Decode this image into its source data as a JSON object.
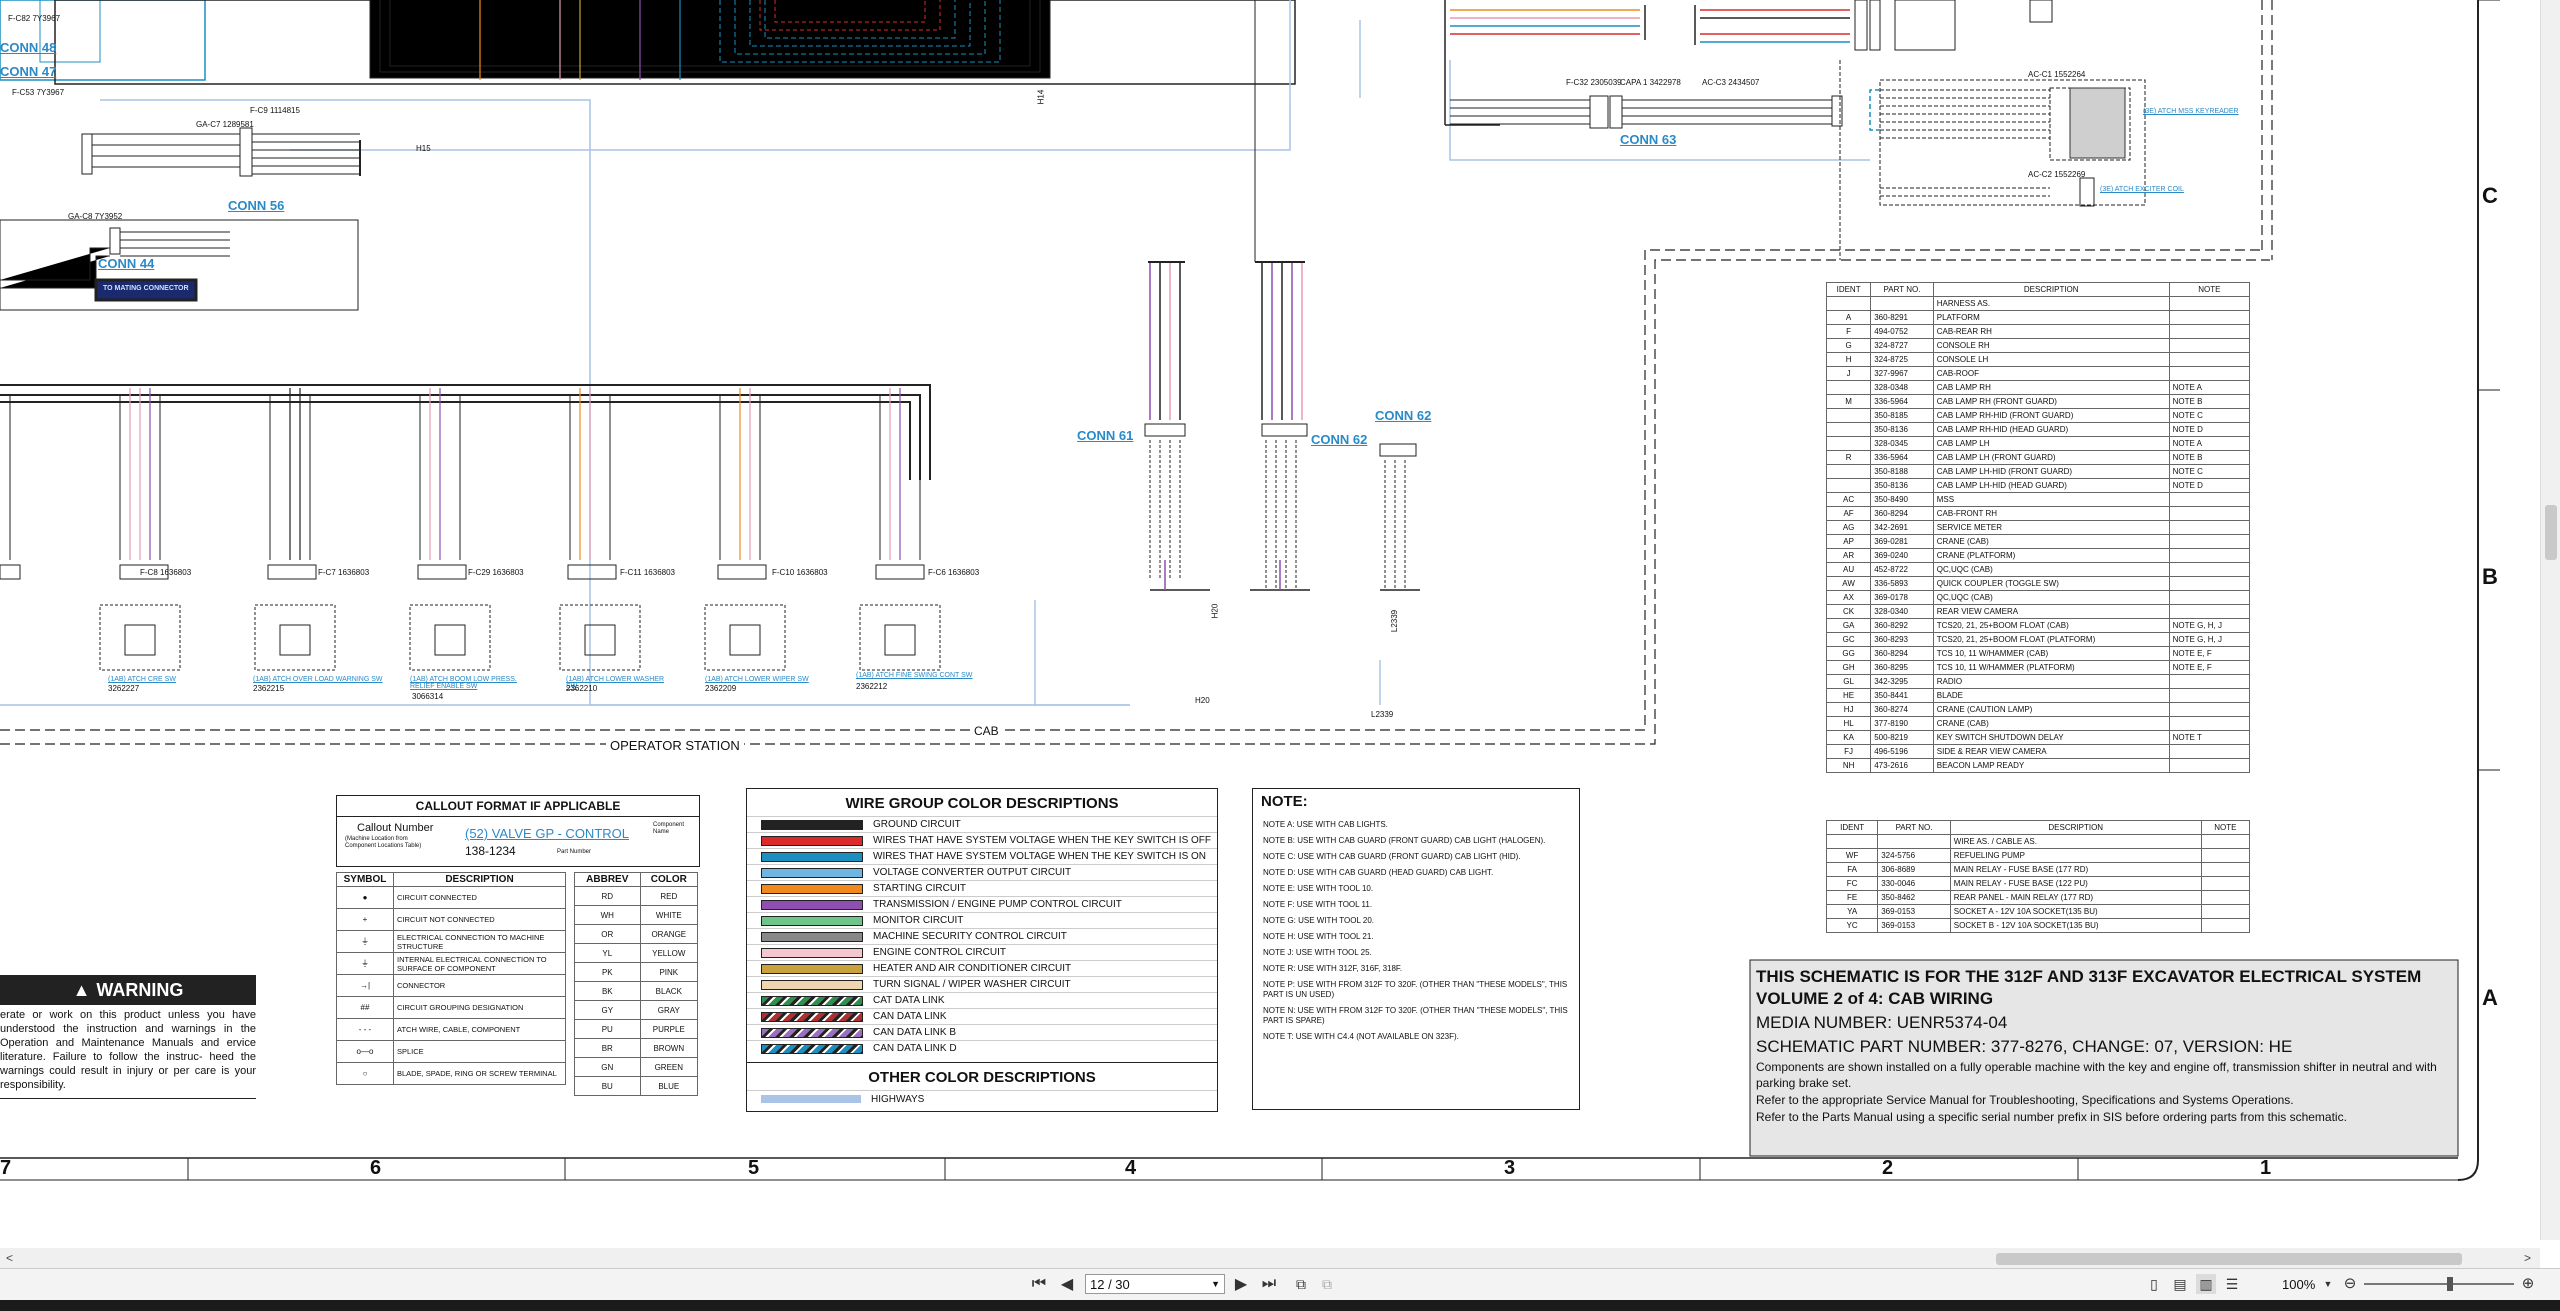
{
  "connectors": {
    "conn48": "CONN 48",
    "conn47": "CONN 47",
    "conn56": "CONN 56",
    "conn44": "CONN 44",
    "conn61": "CONN 61",
    "conn62a": "CONN 62",
    "conn62b": "CONN 62",
    "conn63": "CONN 63"
  },
  "tags": {
    "to_mating": "TO MATING CONNECTOR",
    "operator_station": "OPERATOR STATION",
    "cab": "CAB",
    "h15": "H15",
    "h14": "H14",
    "h20a": "H20",
    "h20b": "H20",
    "l2339a": "L2339",
    "l2339b": "L2339",
    "ac_c1_addr": "AC-C1 1552264",
    "ac_c2_addr": "AC-C2 1552269",
    "keypad_link": "(3E) ATCH MSS KEYREADER",
    "exciter_link": "(3E) ATCH EXCITER COIL",
    "fc32": "F-C32 2305039",
    "capa1": "CAPA 1 3422978",
    "acc3": "AC-C3 2434507",
    "fc9": "F-C9 1114815",
    "gac7": "GA-C7 1289581",
    "gac8": "GA-C8 7Y3952",
    "fc82": "F-C82 7Y3967",
    "fc53": "F-C53 7Y3967"
  },
  "switches": [
    {
      "name": "(1AB) ATCH CRE SW",
      "part": "3262227",
      "conn": "F-C8 1636803"
    },
    {
      "name": "(1AB) ATCH OVER LOAD WARNING SW",
      "part": "2362215",
      "conn": "F-C7 1636803"
    },
    {
      "name": "(1AB) ATCH BOOM LOW PRESS. RELIEF ENABLE SW",
      "part": "3066314",
      "conn": "F-C29 1636803"
    },
    {
      "name": "(1AB) ATCH LOWER WASHER SW",
      "part": "2362210",
      "conn": "F-C11 1636803"
    },
    {
      "name": "(1AB) ATCH LOWER WIPER SW",
      "part": "2362209",
      "conn": "F-C10 1636803"
    },
    {
      "name": "(1AB) ATCH FINE SWING CONT SW",
      "part": "2362212",
      "conn": "F-C6 1636803"
    }
  ],
  "callout": {
    "title": "CALLOUT FORMAT IF APPLICABLE",
    "callout_number": "Callout Number",
    "machine_loc": "(Machine Location from Component Locations Table)",
    "valve_text": "(52) VALVE GP - CONTROL",
    "component_name": "Component Name",
    "part_number_value": "138-1234",
    "part_number_label": "Part Number"
  },
  "symbols": {
    "header": [
      "SYMBOL",
      "DESCRIPTION"
    ],
    "rows": [
      "CIRCUIT CONNECTED",
      "CIRCUIT NOT CONNECTED",
      "ELECTRICAL CONNECTION TO MACHINE STRUCTURE",
      "INTERNAL ELECTRICAL CONNECTION TO SURFACE OF COMPONENT",
      "CONNECTOR",
      "CIRCUIT GROUPING DESIGNATION",
      "ATCH WIRE, CABLE, COMPONENT",
      "SPLICE",
      "BLADE, SPADE, RING OR SCREW TERMINAL"
    ],
    "glyphs": [
      "●",
      "+",
      "⏚",
      "⏚",
      "→|",
      "##",
      "- - -",
      "o—o",
      "○"
    ]
  },
  "abbrev": {
    "header": [
      "ABBREV",
      "COLOR"
    ],
    "rows": [
      [
        "RD",
        "RED"
      ],
      [
        "WH",
        "WHITE"
      ],
      [
        "OR",
        "ORANGE"
      ],
      [
        "YL",
        "YELLOW"
      ],
      [
        "PK",
        "PINK"
      ],
      [
        "BK",
        "BLACK"
      ],
      [
        "GY",
        "GRAY"
      ],
      [
        "PU",
        "PURPLE"
      ],
      [
        "BR",
        "BROWN"
      ],
      [
        "GN",
        "GREEN"
      ],
      [
        "BU",
        "BLUE"
      ]
    ]
  },
  "wire_groups": {
    "title": "WIRE GROUP COLOR DESCRIPTIONS",
    "rows": [
      {
        "label": "GROUND CIRCUIT",
        "color": "#222222",
        "style": "solid"
      },
      {
        "label": "WIRES THAT HAVE SYSTEM VOLTAGE WHEN THE KEY SWITCH IS OFF",
        "color": "#d92b2b",
        "style": "solid"
      },
      {
        "label": "WIRES THAT HAVE SYSTEM VOLTAGE WHEN THE KEY SWITCH IS ON",
        "color": "#1b8fc0",
        "style": "solid"
      },
      {
        "label": "VOLTAGE CONVERTER OUTPUT CIRCUIT",
        "color": "#6fb6e0",
        "style": "solid"
      },
      {
        "label": "STARTING CIRCUIT",
        "color": "#f08a1c",
        "style": "solid"
      },
      {
        "label": "TRANSMISSION / ENGINE PUMP CONTROL CIRCUIT",
        "color": "#8e4fb0",
        "style": "solid"
      },
      {
        "label": "MONITOR CIRCUIT",
        "color": "#6fc48a",
        "style": "solid"
      },
      {
        "label": "MACHINE SECURITY CONTROL CIRCUIT",
        "color": "#888888",
        "style": "solid"
      },
      {
        "label": "ENGINE CONTROL CIRCUIT",
        "color": "#f4c6d0",
        "style": "solid"
      },
      {
        "label": "HEATER AND AIR CONDITIONER CIRCUIT",
        "color": "#c9a23b",
        "style": "solid"
      },
      {
        "label": "TURN SIGNAL / WIPER WASHER CIRCUIT",
        "color": "#f0d6b0",
        "style": "solid"
      },
      {
        "label": "CAT DATA LINK",
        "color": "#2f8f4f",
        "style": "hatch"
      },
      {
        "label": "CAN DATA LINK",
        "color": "#b03030",
        "style": "hatch"
      },
      {
        "label": "CAN DATA LINK B",
        "color": "#9a6fc0",
        "style": "hatch"
      },
      {
        "label": "CAN DATA LINK D",
        "color": "#1b8fc0",
        "style": "hatch"
      }
    ],
    "other_title": "OTHER COLOR DESCRIPTIONS",
    "other_rows": [
      {
        "label": "HIGHWAYS",
        "color": "#a9c4e6"
      }
    ]
  },
  "notes": {
    "title": "NOTE:",
    "items": [
      "NOTE A: USE WITH CAB LIGHTS.",
      "NOTE B: USE WITH CAB GUARD (FRONT GUARD) CAB LIGHT (HALOGEN).",
      "NOTE C: USE WITH CAB GUARD (FRONT GUARD) CAB LIGHT (HID).",
      "NOTE D: USE WITH CAB GUARD (HEAD GUARD) CAB LIGHT.",
      "NOTE E: USE WITH TOOL 10.",
      "NOTE F: USE WITH TOOL 11.",
      "NOTE G: USE WITH TOOL 20.",
      "NOTE H: USE WITH TOOL 21.",
      "NOTE J: USE WITH TOOL 25.",
      "NOTE R: USE WITH 312F, 316F, 318F.",
      "NOTE P: USE WITH FROM 312F TO 320F. (OTHER THAN \"THESE MODELS\", THIS PART IS UN USED)",
      "NOTE N: USE WITH FROM 312F TO 320F. (OTHER THAN \"THESE MODELS\", THIS PART IS SPARE)",
      "NOTE T: USE WITH C4.4 (NOT AVAILABLE ON 323F)."
    ]
  },
  "harness_table": {
    "header": [
      "IDENT",
      "PART NO.",
      "DESCRIPTION",
      "NOTE"
    ],
    "subheader": "HARNESS AS.",
    "rows": [
      [
        "A",
        "360-8291",
        "PLATFORM",
        ""
      ],
      [
        "F",
        "494-0752",
        "CAB-REAR RH",
        ""
      ],
      [
        "G",
        "324-8727",
        "CONSOLE RH",
        ""
      ],
      [
        "H",
        "324-8725",
        "CONSOLE LH",
        ""
      ],
      [
        "J",
        "327-9967",
        "CAB-ROOF",
        ""
      ],
      [
        "",
        "328-0348",
        "CAB LAMP RH",
        "NOTE A"
      ],
      [
        "M",
        "336-5964",
        "CAB LAMP RH (FRONT GUARD)",
        "NOTE B"
      ],
      [
        "",
        "350-8185",
        "CAB LAMP RH-HID (FRONT GUARD)",
        "NOTE C"
      ],
      [
        "",
        "350-8136",
        "CAB LAMP RH-HID (HEAD GUARD)",
        "NOTE D"
      ],
      [
        "",
        "328-0345",
        "CAB LAMP LH",
        "NOTE A"
      ],
      [
        "R",
        "336-5964",
        "CAB LAMP LH (FRONT GUARD)",
        "NOTE B"
      ],
      [
        "",
        "350-8188",
        "CAB LAMP LH-HID (FRONT GUARD)",
        "NOTE C"
      ],
      [
        "",
        "350-8136",
        "CAB LAMP LH-HID (HEAD GUARD)",
        "NOTE D"
      ],
      [
        "AC",
        "350-8490",
        "MSS",
        ""
      ],
      [
        "AF",
        "360-8294",
        "CAB-FRONT RH",
        ""
      ],
      [
        "AG",
        "342-2691",
        "SERVICE METER",
        ""
      ],
      [
        "AP",
        "369-0281",
        "CRANE (CAB)",
        ""
      ],
      [
        "AR",
        "369-0240",
        "CRANE (PLATFORM)",
        ""
      ],
      [
        "AU",
        "452-8722",
        "QC,UQC (CAB)",
        ""
      ],
      [
        "AW",
        "336-5893",
        "QUICK COUPLER (TOGGLE SW)",
        ""
      ],
      [
        "AX",
        "369-0178",
        "QC,UQC (CAB)",
        ""
      ],
      [
        "CK",
        "328-0340",
        "REAR VIEW CAMERA",
        ""
      ],
      [
        "GA",
        "360-8292",
        "TCS20, 21, 25+BOOM FLOAT (CAB)",
        "NOTE G, H, J"
      ],
      [
        "GC",
        "360-8293",
        "TCS20, 21, 25+BOOM FLOAT (PLATFORM)",
        "NOTE G, H, J"
      ],
      [
        "GG",
        "360-8294",
        "TCS 10, 11 W/HAMMER (CAB)",
        "NOTE E, F"
      ],
      [
        "GH",
        "360-8295",
        "TCS 10, 11 W/HAMMER (PLATFORM)",
        "NOTE E, F"
      ],
      [
        "GL",
        "342-3295",
        "RADIO",
        ""
      ],
      [
        "HE",
        "350-8441",
        "BLADE",
        ""
      ],
      [
        "HJ",
        "360-8274",
        "CRANE (CAUTION LAMP)",
        ""
      ],
      [
        "HL",
        "377-8190",
        "CRANE (CAB)",
        ""
      ],
      [
        "KA",
        "500-8219",
        "KEY SWITCH SHUTDOWN DELAY",
        "NOTE T"
      ],
      [
        "FJ",
        "496-5196",
        "SIDE & REAR VIEW CAMERA",
        ""
      ],
      [
        "NH",
        "473-2616",
        "BEACON LAMP READY",
        ""
      ]
    ]
  },
  "wire_table": {
    "header": [
      "IDENT",
      "PART NO.",
      "DESCRIPTION",
      "NOTE"
    ],
    "subheader": "WIRE AS. / CABLE AS.",
    "rows": [
      [
        "WF",
        "324-5756",
        "REFUELING PUMP",
        ""
      ],
      [
        "FA",
        "306-8689",
        "MAIN RELAY - FUSE BASE (177 RD)",
        ""
      ],
      [
        "FC",
        "330-0046",
        "MAIN RELAY - FUSE BASE (122 PU)",
        ""
      ],
      [
        "FE",
        "350-8462",
        "REAR PANEL - MAIN RELAY (177 RD)",
        ""
      ],
      [
        "YA",
        "369-0153",
        "SOCKET A - 12V 10A SOCKET(135 BU)",
        ""
      ],
      [
        "YC",
        "369-0153",
        "SOCKET B - 12V 10A SOCKET(135 BU)",
        ""
      ]
    ]
  },
  "title_block": {
    "line1": "THIS SCHEMATIC IS FOR THE 312F AND 313F EXCAVATOR ELECTRICAL SYSTEM",
    "line2": "VOLUME 2 of 4: CAB WIRING",
    "line3": "MEDIA NUMBER: UENR5374-04",
    "line4": "SCHEMATIC PART NUMBER: 377-8276, CHANGE: 07, VERSION: HE",
    "line5": "Components are shown installed on a fully operable machine with the key and engine off, transmission shifter in neutral and with parking brake set.",
    "line6": "Refer to the appropriate Service Manual for Troubleshooting, Specifications and Systems Operations.",
    "line7": "Refer to the Parts Manual using a specific serial number prefix in SIS before ordering parts from this schematic."
  },
  "warning": {
    "title": "WARNING",
    "body": "erate or work on this product unless you have understood the instruction and warnings in the Operation and Maintenance Manuals and ervice literature. Failure to follow the instruc- heed the warnings could result in injury or per care is your responsibility."
  },
  "zones": {
    "cols": [
      "7",
      "6",
      "5",
      "4",
      "3",
      "2",
      "1"
    ],
    "rows": [
      "C",
      "B",
      "A"
    ]
  },
  "viewer": {
    "page_value": "12 / 30",
    "zoom": "100%",
    "first": "⏮",
    "prev": "◀",
    "next": "▶",
    "last": "⏭"
  },
  "colors": {
    "link_blue": "#2a8ac8",
    "highway": "#a9c4e6",
    "purple": "#8e4fb0",
    "pink": "#e79bb4",
    "orange": "#f08a1c"
  }
}
